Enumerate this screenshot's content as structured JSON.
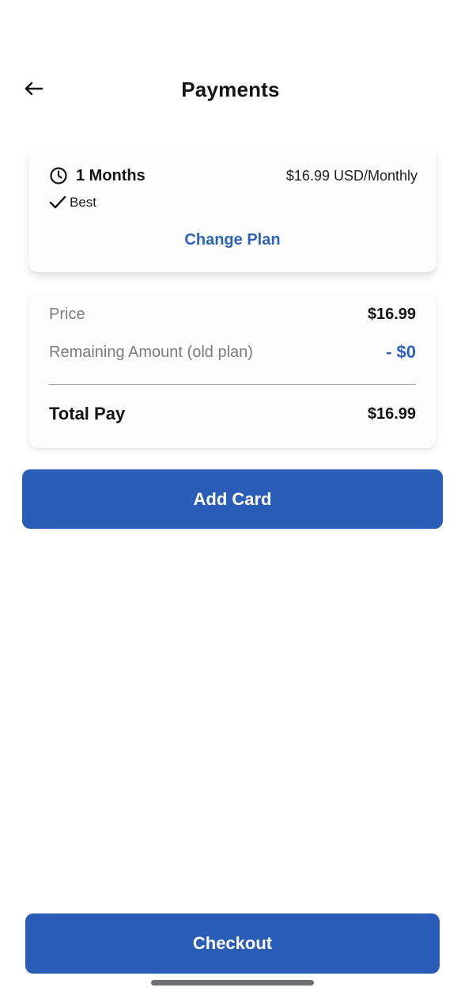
{
  "header": {
    "title": "Payments",
    "back_icon": "arrow-left-icon"
  },
  "plan": {
    "icon": "clock-icon",
    "name": "1 Months",
    "price": "$16.99 USD/Monthly",
    "badge_icon": "checkmark-icon",
    "badge": "Best",
    "change_label": "Change Plan"
  },
  "summary": {
    "price_label": "Price",
    "price_value": "$16.99",
    "remaining_label": "Remaining Amount (old plan)",
    "remaining_value": "- $0",
    "total_label": "Total Pay",
    "total_value": "$16.99"
  },
  "actions": {
    "add_card": "Add Card",
    "checkout": "Checkout"
  },
  "colors": {
    "accent": "#2a5db8",
    "link": "#2d62bd",
    "muted_text": "#7a7a80"
  }
}
